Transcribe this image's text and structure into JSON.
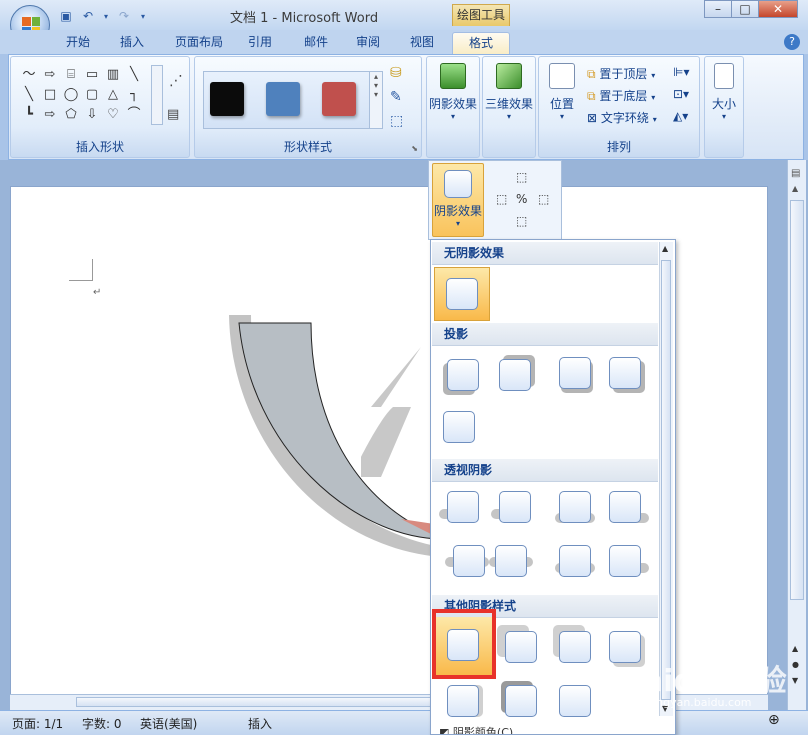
{
  "window": {
    "title": "文档 1 - Microsoft Word",
    "contextual_tab": "绘图工具",
    "minimize": "–",
    "restore": "□",
    "close": "✕"
  },
  "tabs": [
    {
      "label": "开始"
    },
    {
      "label": "插入"
    },
    {
      "label": "页面布局"
    },
    {
      "label": "引用"
    },
    {
      "label": "邮件"
    },
    {
      "label": "审阅"
    },
    {
      "label": "视图"
    },
    {
      "label": "格式"
    }
  ],
  "ribbon": {
    "insert_shapes_label": "插入形状",
    "shape_styles_label": "形状样式",
    "arrange_label": "排列",
    "shadow_effects": "阴影效果",
    "three_d_effects": "三维效果",
    "position": "位置",
    "bring_to_front": "置于顶层",
    "send_to_back": "置于底层",
    "text_wrapping": "文字环绕",
    "size": "大小",
    "swatch_colors": [
      "#0b0b0b",
      "#4f81bd",
      "#c0504d"
    ]
  },
  "flyout": {
    "shadow_effects": "阴影效果"
  },
  "dropdown": {
    "sections": [
      {
        "title": "无阴影效果"
      },
      {
        "title": "投影"
      },
      {
        "title": "透视阴影"
      },
      {
        "title": "其他阴影样式"
      }
    ],
    "footer": "阴影颜色(C)"
  },
  "statusbar": {
    "page": "页面: 1/1",
    "words": "字数: 0",
    "language": "英语(美国)",
    "insert": "插入"
  },
  "watermark": {
    "brand": "Baidu 经验",
    "url": "jingyan.baidu.com"
  }
}
